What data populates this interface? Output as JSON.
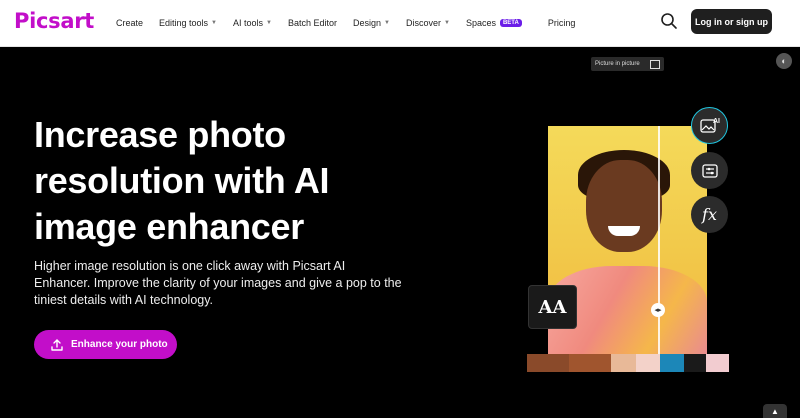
{
  "header": {
    "logo": "Picsart",
    "nav": [
      {
        "label": "Create",
        "dropdown": false
      },
      {
        "label": "Editing tools",
        "dropdown": true
      },
      {
        "label": "AI tools",
        "dropdown": true
      },
      {
        "label": "Batch Editor",
        "dropdown": false
      },
      {
        "label": "Design",
        "dropdown": true
      },
      {
        "label": "Discover",
        "dropdown": true
      },
      {
        "label": "Spaces",
        "dropdown": false,
        "badge": "BETA"
      },
      {
        "label": "Pricing",
        "dropdown": false
      }
    ],
    "login_label": "Log in or sign up"
  },
  "pip_label": "Picture in picture",
  "hero": {
    "title": "Increase photo resolution with AI image enhancer",
    "subtitle": "Higher image resolution is one click away with Picsart AI Enhancer. Improve the clarity of your images and give a pop to the tiniest details with AI technology.",
    "cta_label": "Enhance your photo"
  },
  "tools": [
    {
      "name": "ai-image-icon",
      "label": "AI",
      "active": true
    },
    {
      "name": "adjust-icon",
      "label": "",
      "active": false
    },
    {
      "name": "effects-icon",
      "label": "fx",
      "active": false
    }
  ],
  "font_tile": "AA",
  "palette": [
    "#8a4a2a",
    "#a0552e",
    "#e8b998",
    "#f3d2c9",
    "#1c87b8",
    "#1a1a1a",
    "#f2ccd0"
  ],
  "colors": {
    "brand": "#c20ec9",
    "beta": "#6b1de8",
    "active_ring": "#21c6e0"
  }
}
